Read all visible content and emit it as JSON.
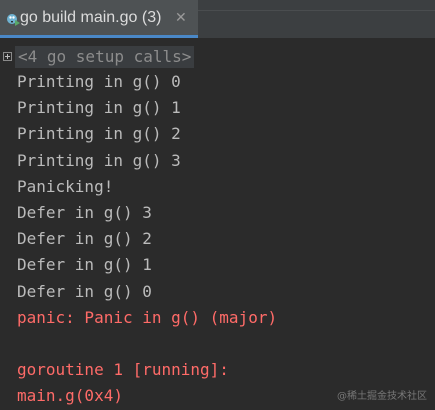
{
  "tab": {
    "title": "go build main.go (3)",
    "close_glyph": "✕",
    "icon": "go-run-icon"
  },
  "console": {
    "fold": "<4 go setup calls>",
    "lines": [
      {
        "text": "Printing in g() 0",
        "kind": "stdout"
      },
      {
        "text": "Printing in g() 1",
        "kind": "stdout"
      },
      {
        "text": "Printing in g() 2",
        "kind": "stdout"
      },
      {
        "text": "Printing in g() 3",
        "kind": "stdout"
      },
      {
        "text": "Panicking!",
        "kind": "stdout"
      },
      {
        "text": "Defer in g() 3",
        "kind": "stdout"
      },
      {
        "text": "Defer in g() 2",
        "kind": "stdout"
      },
      {
        "text": "Defer in g() 1",
        "kind": "stdout"
      },
      {
        "text": "Defer in g() 0",
        "kind": "stdout"
      },
      {
        "text": "panic: Panic in g() (major)",
        "kind": "stderr"
      },
      {
        "text": "",
        "kind": "stderr"
      },
      {
        "text": "goroutine 1 [running]:",
        "kind": "stderr"
      },
      {
        "text": "main.g(0x4)",
        "kind": "stderr"
      }
    ]
  },
  "watermark": "@稀土掘金技术社区",
  "colors": {
    "background": "#2b2b2b",
    "stdout": "#bbbbbb",
    "stderr": "#ff6b68",
    "tab_underline": "#4a88c7"
  }
}
